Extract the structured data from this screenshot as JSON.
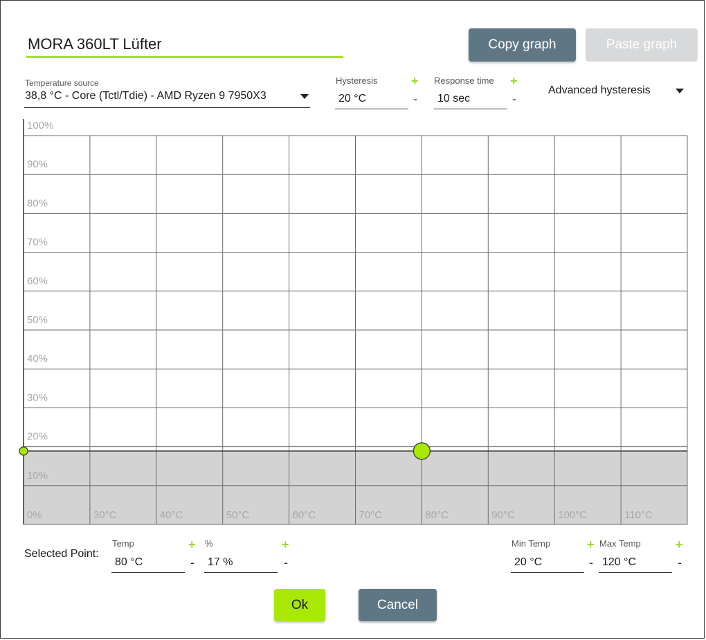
{
  "dialog": {
    "name": "MORA 360LT Lüfter",
    "copy_label": "Copy graph",
    "paste_label": "Paste graph"
  },
  "temperature_source": {
    "label": "Temperature source",
    "value": "38,8 °C - Core (Tctl/Tdie) - AMD Ryzen 9 7950X3"
  },
  "hysteresis": {
    "label": "Hysteresis",
    "value": "20 °C",
    "plus": "+",
    "minus": "-"
  },
  "response_time": {
    "label": "Response time",
    "value": "10 sec",
    "plus": "+",
    "minus": "-"
  },
  "advanced_hysteresis": {
    "label": "Advanced hysteresis"
  },
  "chart_data": {
    "type": "line",
    "x_tick_labels": [
      "0%",
      "30°C",
      "40°C",
      "50°C",
      "60°C",
      "70°C",
      "80°C",
      "90°C",
      "100°C",
      "110°C"
    ],
    "y_tick_labels": [
      "100%",
      "90%",
      "80%",
      "70%",
      "60%",
      "50%",
      "40%",
      "30%",
      "20%",
      "10%"
    ],
    "xlim": [
      20,
      120
    ],
    "ylim": [
      0,
      100
    ],
    "points": [
      {
        "x": 20,
        "y": 17
      },
      {
        "x": 80,
        "y": 17
      }
    ],
    "selected_point_index": 1,
    "grid": true,
    "colors": {
      "point": "#a9e805",
      "fill": "#d3d3d3",
      "grid": "#6b6b6b",
      "tick": "#a8a8a8"
    }
  },
  "selected_point": {
    "label": "Selected Point:",
    "temp_label": "Temp",
    "temp_value": "80 °C",
    "pct_label": "%",
    "pct_value": "17 %",
    "plus": "+",
    "minus": "-"
  },
  "min_temp": {
    "label": "Min Temp",
    "value": "20 °C",
    "plus": "+",
    "minus": "-"
  },
  "max_temp": {
    "label": "Max Temp",
    "value": "120 °C",
    "plus": "+",
    "minus": "-"
  },
  "footer": {
    "ok_label": "Ok",
    "cancel_label": "Cancel"
  },
  "colors": {
    "accent": "#a9e805",
    "button": "#5f7784",
    "button_disabled": "#d7d9da"
  }
}
